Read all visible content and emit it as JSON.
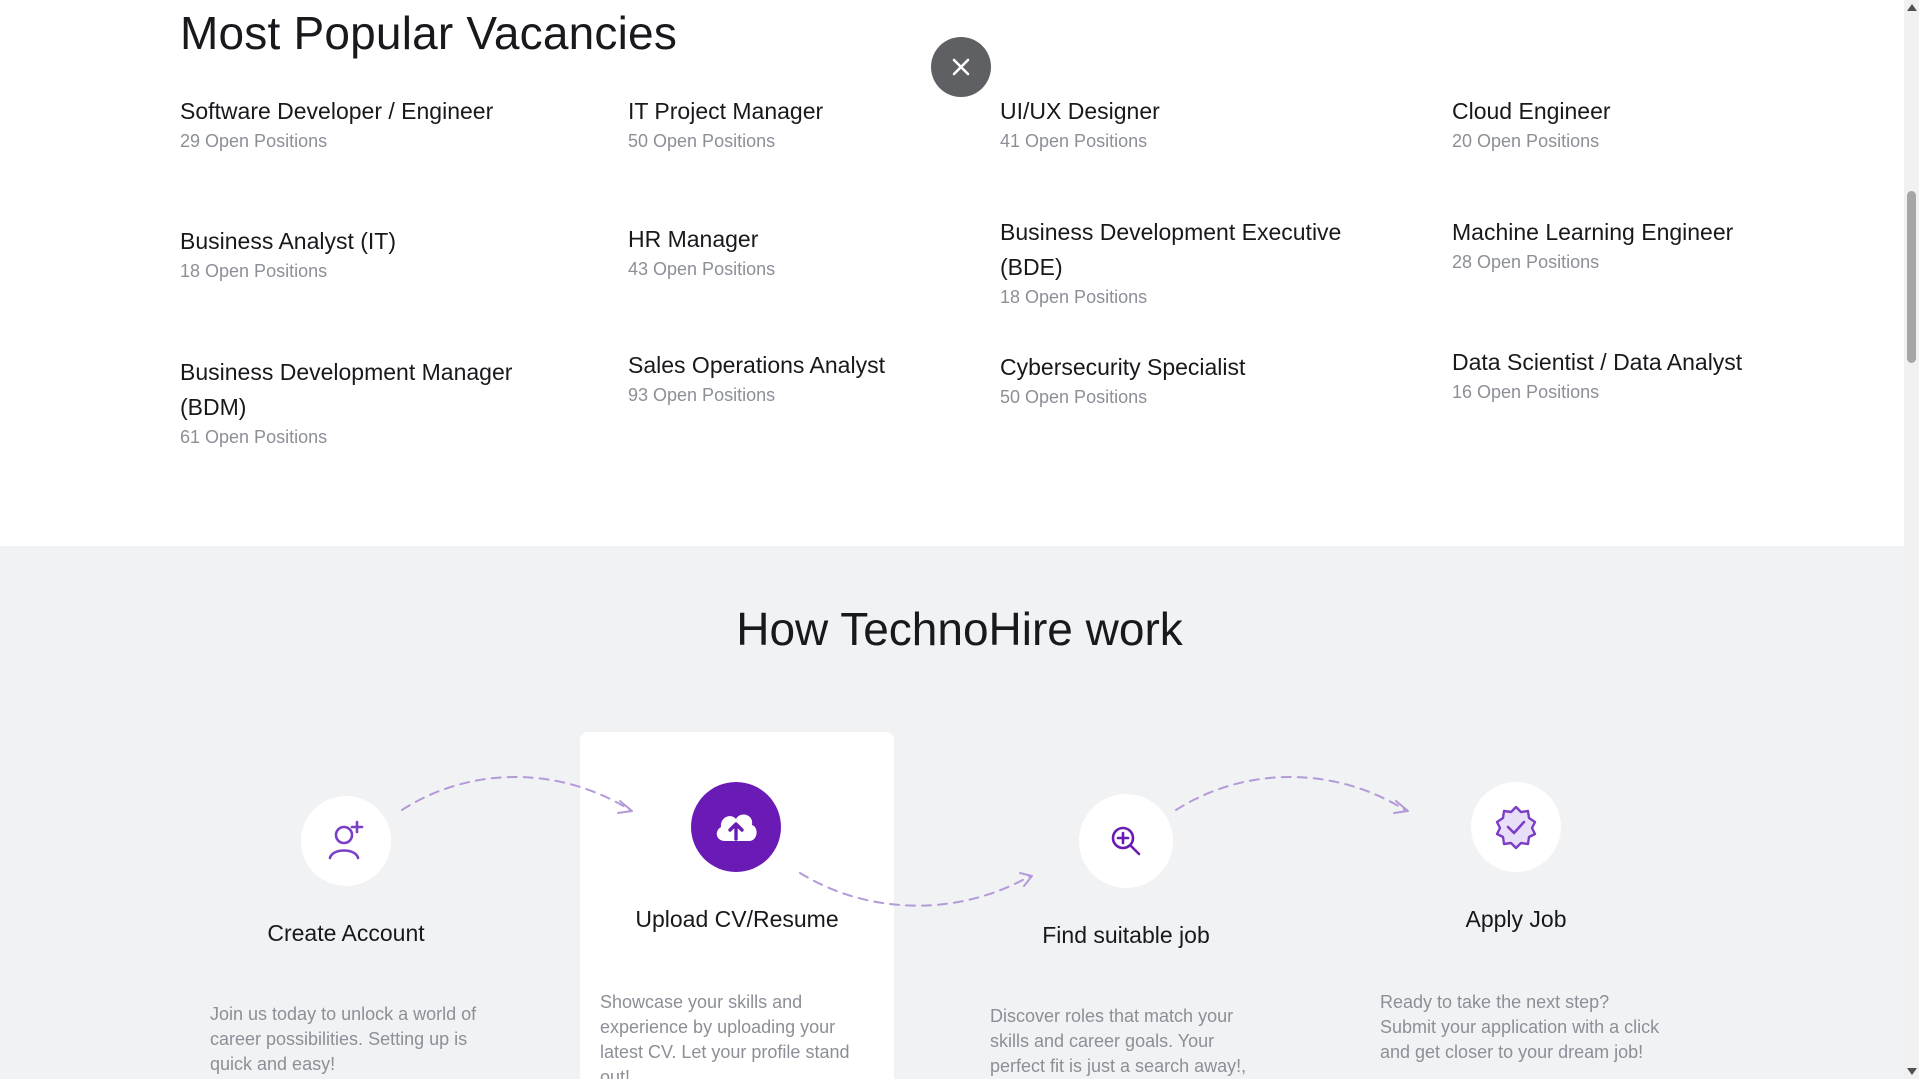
{
  "vacancies": {
    "title": "Most Popular Vacancies",
    "items": [
      {
        "name": "Software Developer / Engineer",
        "count": "29 Open Positions"
      },
      {
        "name": "IT Project Manager",
        "count": "50 Open Positions"
      },
      {
        "name": "UI/UX Designer",
        "count": "41 Open Positions"
      },
      {
        "name": "Cloud Engineer",
        "count": "20 Open Positions"
      },
      {
        "name": "Business Analyst (IT)",
        "count": "18 Open Positions"
      },
      {
        "name": "HR Manager",
        "count": "43 Open Positions"
      },
      {
        "name": "Business Development Executive (BDE)",
        "count": "18 Open Positions"
      },
      {
        "name": "Machine Learning Engineer",
        "count": "28 Open Positions"
      },
      {
        "name": "Business Development Manager (BDM)",
        "count": "61 Open Positions"
      },
      {
        "name": "Sales Operations Analyst",
        "count": "93 Open Positions"
      },
      {
        "name": "Cybersecurity Specialist",
        "count": "50 Open Positions"
      },
      {
        "name": "Data Scientist / Data Analyst",
        "count": "16 Open Positions"
      }
    ]
  },
  "close_button": {
    "icon": "close-icon"
  },
  "how_it_works": {
    "title": "How TechnoHire work",
    "steps": [
      {
        "title": "Create Account",
        "icon": "add-user-icon",
        "description": "Join us today to unlock a world of career possibilities. Setting up is quick and easy!"
      },
      {
        "title": "Upload CV/Resume",
        "icon": "cloud-upload-icon",
        "description": "Showcase your skills and experience by uploading your latest CV. Let your profile stand out!"
      },
      {
        "title": "Find suitable job",
        "icon": "search-plus-icon",
        "description": "Discover roles that match your skills and career goals. Your perfect fit is just a search away!,"
      },
      {
        "title": "Apply Job",
        "icon": "verified-badge-icon",
        "description": "Ready to take the next step? Submit your application with a click and get closer to your dream job!"
      }
    ]
  },
  "colors": {
    "accent": "#6a1bb5",
    "accent_light": "#7b3fc6",
    "section_bg": "#f1f2f4",
    "muted_text": "#8c8f97",
    "close_bg": "#5f6063"
  }
}
